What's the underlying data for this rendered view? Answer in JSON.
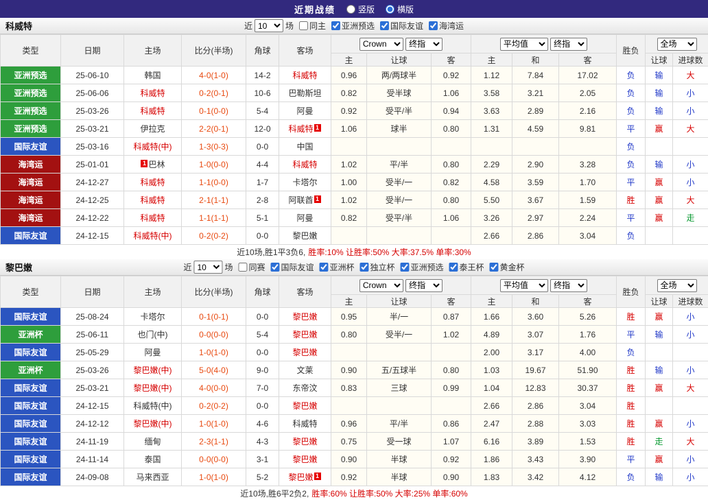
{
  "topbar": {
    "title": "近期战绩",
    "radios": [
      {
        "label": "竖版",
        "checked": false
      },
      {
        "label": "横版",
        "checked": true
      }
    ]
  },
  "table_header": {
    "type": "类型",
    "date": "日期",
    "home": "主场",
    "score": "比分(半场)",
    "corners": "角球",
    "away": "客场",
    "odds_select": "Crown",
    "stage": "终指",
    "odds_cols": [
      "主",
      "让球",
      "客"
    ],
    "avg_select": "平均值",
    "avg_cols": [
      "主",
      "和",
      "客"
    ],
    "result": "胜负",
    "full_select": "全场",
    "full_cols": [
      "让球",
      "进球数"
    ]
  },
  "type_colors": {
    "亚洲预选": "#2e9e3c",
    "国际友谊": "#2b55c0",
    "海湾运": "#a31111",
    "亚洲杯": "#2e9e3c"
  },
  "result_colors": {
    "胜": "#d60000",
    "平": "#2038c8",
    "负": "#2038c8",
    "赢": "#d60000",
    "输": "#2038c8",
    "走": "#089830",
    "大": "#d60000",
    "小": "#2038c8"
  },
  "sections": [
    {
      "team": "科威特",
      "filter": {
        "near": "近",
        "count": "10",
        "unit": "场",
        "checkboxes": [
          {
            "label": "同主",
            "checked": false
          },
          {
            "label": "亚洲预选",
            "checked": true
          },
          {
            "label": "国际友谊",
            "checked": true
          },
          {
            "label": "海湾运",
            "checked": true
          }
        ]
      },
      "rows": [
        {
          "type": "亚洲预选",
          "date": "25-06-10",
          "home": {
            "name": "韩国",
            "focal": false,
            "card": ""
          },
          "score": "4-0(1-0)",
          "corners": "14-2",
          "away": {
            "name": "科威特",
            "focal": true,
            "card": ""
          },
          "let": [
            "0.96",
            "两/两球半",
            "0.92"
          ],
          "avg": [
            "1.12",
            "7.84",
            "17.02"
          ],
          "res": "负",
          "let_res": "输",
          "goal_res": "大"
        },
        {
          "type": "亚洲预选",
          "date": "25-06-06",
          "home": {
            "name": "科威特",
            "focal": true,
            "card": ""
          },
          "score": "0-2(0-1)",
          "corners": "10-6",
          "away": {
            "name": "巴勒斯坦",
            "focal": false,
            "card": ""
          },
          "let": [
            "0.82",
            "受半球",
            "1.06"
          ],
          "avg": [
            "3.58",
            "3.21",
            "2.05"
          ],
          "res": "负",
          "let_res": "输",
          "goal_res": "小"
        },
        {
          "type": "亚洲预选",
          "date": "25-03-26",
          "home": {
            "name": "科威特",
            "focal": true,
            "card": ""
          },
          "score": "0-1(0-0)",
          "corners": "5-4",
          "away": {
            "name": "阿曼",
            "focal": false,
            "card": ""
          },
          "let": [
            "0.92",
            "受平/半",
            "0.94"
          ],
          "avg": [
            "3.63",
            "2.89",
            "2.16"
          ],
          "res": "负",
          "let_res": "输",
          "goal_res": "小"
        },
        {
          "type": "亚洲预选",
          "date": "25-03-21",
          "home": {
            "name": "伊拉克",
            "focal": false,
            "card": ""
          },
          "score": "2-2(0-1)",
          "corners": "12-0",
          "away": {
            "name": "科威特",
            "focal": true,
            "card": "right"
          },
          "let": [
            "1.06",
            "球半",
            "0.80"
          ],
          "avg": [
            "1.31",
            "4.59",
            "9.81"
          ],
          "res": "平",
          "let_res": "赢",
          "goal_res": "大"
        },
        {
          "type": "国际友谊",
          "date": "25-03-16",
          "home": {
            "name": "科威特(中)",
            "focal": true,
            "card": ""
          },
          "score": "1-3(0-3)",
          "corners": "0-0",
          "away": {
            "name": "中国",
            "focal": false,
            "card": ""
          },
          "let": [
            "",
            "",
            ""
          ],
          "avg": [
            "",
            "",
            ""
          ],
          "res": "负",
          "let_res": "",
          "goal_res": ""
        },
        {
          "type": "海湾运",
          "date": "25-01-01",
          "home": {
            "name": "巴林",
            "focal": false,
            "card": "left"
          },
          "score": "1-0(0-0)",
          "corners": "4-4",
          "away": {
            "name": "科威特",
            "focal": true,
            "card": ""
          },
          "let": [
            "1.02",
            "平/半",
            "0.80"
          ],
          "avg": [
            "2.29",
            "2.90",
            "3.28"
          ],
          "res": "负",
          "let_res": "输",
          "goal_res": "小"
        },
        {
          "type": "海湾运",
          "date": "24-12-27",
          "home": {
            "name": "科威特",
            "focal": true,
            "card": ""
          },
          "score": "1-1(0-0)",
          "corners": "1-7",
          "away": {
            "name": "卡塔尔",
            "focal": false,
            "card": ""
          },
          "let": [
            "1.00",
            "受半/一",
            "0.82"
          ],
          "avg": [
            "4.58",
            "3.59",
            "1.70"
          ],
          "res": "平",
          "let_res": "赢",
          "goal_res": "小"
        },
        {
          "type": "海湾运",
          "date": "24-12-25",
          "home": {
            "name": "科威特",
            "focal": true,
            "card": ""
          },
          "score": "2-1(1-1)",
          "corners": "2-8",
          "away": {
            "name": "阿联酋",
            "focal": false,
            "card": "right"
          },
          "let": [
            "1.02",
            "受半/一",
            "0.80"
          ],
          "avg": [
            "5.50",
            "3.67",
            "1.59"
          ],
          "res": "胜",
          "let_res": "赢",
          "goal_res": "大"
        },
        {
          "type": "海湾运",
          "date": "24-12-22",
          "home": {
            "name": "科威特",
            "focal": true,
            "card": ""
          },
          "score": "1-1(1-1)",
          "corners": "5-1",
          "away": {
            "name": "阿曼",
            "focal": false,
            "card": ""
          },
          "let": [
            "0.82",
            "受平/半",
            "1.06"
          ],
          "avg": [
            "3.26",
            "2.97",
            "2.24"
          ],
          "res": "平",
          "let_res": "赢",
          "goal_res": "走"
        },
        {
          "type": "国际友谊",
          "date": "24-12-15",
          "home": {
            "name": "科威特(中)",
            "focal": true,
            "card": ""
          },
          "score": "0-2(0-2)",
          "corners": "0-0",
          "away": {
            "name": "黎巴嫩",
            "focal": false,
            "card": ""
          },
          "let": [
            "",
            "",
            ""
          ],
          "avg": [
            "2.66",
            "2.86",
            "3.04"
          ],
          "res": "负",
          "let_res": "",
          "goal_res": ""
        }
      ],
      "summary": {
        "plain": "近10场,胜1平3负6, ",
        "highlight": "胜率:10% 让胜率:50% 大率:37.5% 单率:30%"
      }
    },
    {
      "team": "黎巴嫩",
      "filter": {
        "near": "近",
        "count": "10",
        "unit": "场",
        "checkboxes": [
          {
            "label": "同赛",
            "checked": false
          },
          {
            "label": "国际友谊",
            "checked": true
          },
          {
            "label": "亚洲杯",
            "checked": true
          },
          {
            "label": "独立杯",
            "checked": true
          },
          {
            "label": "亚洲预选",
            "checked": true
          },
          {
            "label": "泰王杯",
            "checked": true
          },
          {
            "label": "黄金杯",
            "checked": true
          }
        ]
      },
      "rows": [
        {
          "type": "国际友谊",
          "date": "25-08-24",
          "home": {
            "name": "卡塔尔",
            "focal": false,
            "card": ""
          },
          "score": "0-1(0-1)",
          "corners": "0-0",
          "away": {
            "name": "黎巴嫩",
            "focal": true,
            "card": ""
          },
          "let": [
            "0.95",
            "半/一",
            "0.87"
          ],
          "avg": [
            "1.66",
            "3.60",
            "5.26"
          ],
          "res": "胜",
          "let_res": "赢",
          "goal_res": "小"
        },
        {
          "type": "亚洲杯",
          "date": "25-06-11",
          "home": {
            "name": "也门(中)",
            "focal": false,
            "card": ""
          },
          "score": "0-0(0-0)",
          "corners": "5-4",
          "away": {
            "name": "黎巴嫩",
            "focal": true,
            "card": ""
          },
          "let": [
            "0.80",
            "受半/一",
            "1.02"
          ],
          "avg": [
            "4.89",
            "3.07",
            "1.76"
          ],
          "res": "平",
          "let_res": "输",
          "goal_res": "小"
        },
        {
          "type": "国际友谊",
          "date": "25-05-29",
          "home": {
            "name": "阿曼",
            "focal": false,
            "card": ""
          },
          "score": "1-0(1-0)",
          "corners": "0-0",
          "away": {
            "name": "黎巴嫩",
            "focal": true,
            "card": ""
          },
          "let": [
            "",
            "",
            ""
          ],
          "avg": [
            "2.00",
            "3.17",
            "4.00"
          ],
          "res": "负",
          "let_res": "",
          "goal_res": ""
        },
        {
          "type": "亚洲杯",
          "date": "25-03-26",
          "home": {
            "name": "黎巴嫩(中)",
            "focal": true,
            "card": ""
          },
          "score": "5-0(4-0)",
          "corners": "9-0",
          "away": {
            "name": "文莱",
            "focal": false,
            "card": ""
          },
          "let": [
            "0.90",
            "五/五球半",
            "0.80"
          ],
          "avg": [
            "1.03",
            "19.67",
            "51.90"
          ],
          "res": "胜",
          "let_res": "输",
          "goal_res": "小"
        },
        {
          "type": "国际友谊",
          "date": "25-03-21",
          "home": {
            "name": "黎巴嫩(中)",
            "focal": true,
            "card": ""
          },
          "score": "4-0(0-0)",
          "corners": "7-0",
          "away": {
            "name": "东帝汶",
            "focal": false,
            "card": ""
          },
          "let": [
            "0.83",
            "三球",
            "0.99"
          ],
          "avg": [
            "1.04",
            "12.83",
            "30.37"
          ],
          "res": "胜",
          "let_res": "赢",
          "goal_res": "大"
        },
        {
          "type": "国际友谊",
          "date": "24-12-15",
          "home": {
            "name": "科威特(中)",
            "focal": false,
            "card": ""
          },
          "score": "0-2(0-2)",
          "corners": "0-0",
          "away": {
            "name": "黎巴嫩",
            "focal": true,
            "card": ""
          },
          "let": [
            "",
            "",
            ""
          ],
          "avg": [
            "2.66",
            "2.86",
            "3.04"
          ],
          "res": "胜",
          "let_res": "",
          "goal_res": ""
        },
        {
          "type": "国际友谊",
          "date": "24-12-12",
          "home": {
            "name": "黎巴嫩(中)",
            "focal": true,
            "card": ""
          },
          "score": "1-0(1-0)",
          "corners": "4-6",
          "away": {
            "name": "科威特",
            "focal": false,
            "card": ""
          },
          "let": [
            "0.96",
            "平/半",
            "0.86"
          ],
          "avg": [
            "2.47",
            "2.88",
            "3.03"
          ],
          "res": "胜",
          "let_res": "赢",
          "goal_res": "小"
        },
        {
          "type": "国际友谊",
          "date": "24-11-19",
          "home": {
            "name": "缅甸",
            "focal": false,
            "card": ""
          },
          "score": "2-3(1-1)",
          "corners": "4-3",
          "away": {
            "name": "黎巴嫩",
            "focal": true,
            "card": ""
          },
          "let": [
            "0.75",
            "受一球",
            "1.07"
          ],
          "avg": [
            "6.16",
            "3.89",
            "1.53"
          ],
          "res": "胜",
          "let_res": "走",
          "goal_res": "大"
        },
        {
          "type": "国际友谊",
          "date": "24-11-14",
          "home": {
            "name": "泰国",
            "focal": false,
            "card": ""
          },
          "score": "0-0(0-0)",
          "corners": "3-1",
          "away": {
            "name": "黎巴嫩",
            "focal": true,
            "card": ""
          },
          "let": [
            "0.90",
            "半球",
            "0.92"
          ],
          "avg": [
            "1.86",
            "3.43",
            "3.90"
          ],
          "res": "平",
          "let_res": "赢",
          "goal_res": "小"
        },
        {
          "type": "国际友谊",
          "date": "24-09-08",
          "home": {
            "name": "马来西亚",
            "focal": false,
            "card": ""
          },
          "score": "1-0(1-0)",
          "corners": "5-2",
          "away": {
            "name": "黎巴嫩",
            "focal": true,
            "card": "right"
          },
          "let": [
            "0.92",
            "半球",
            "0.90"
          ],
          "avg": [
            "1.83",
            "3.42",
            "4.12"
          ],
          "res": "负",
          "let_res": "输",
          "goal_res": "小"
        }
      ],
      "summary": {
        "plain": "近10场,胜6平2负2, ",
        "highlight": "胜率:60% 让胜率:50% 大率:25% 单率:60%"
      }
    }
  ]
}
